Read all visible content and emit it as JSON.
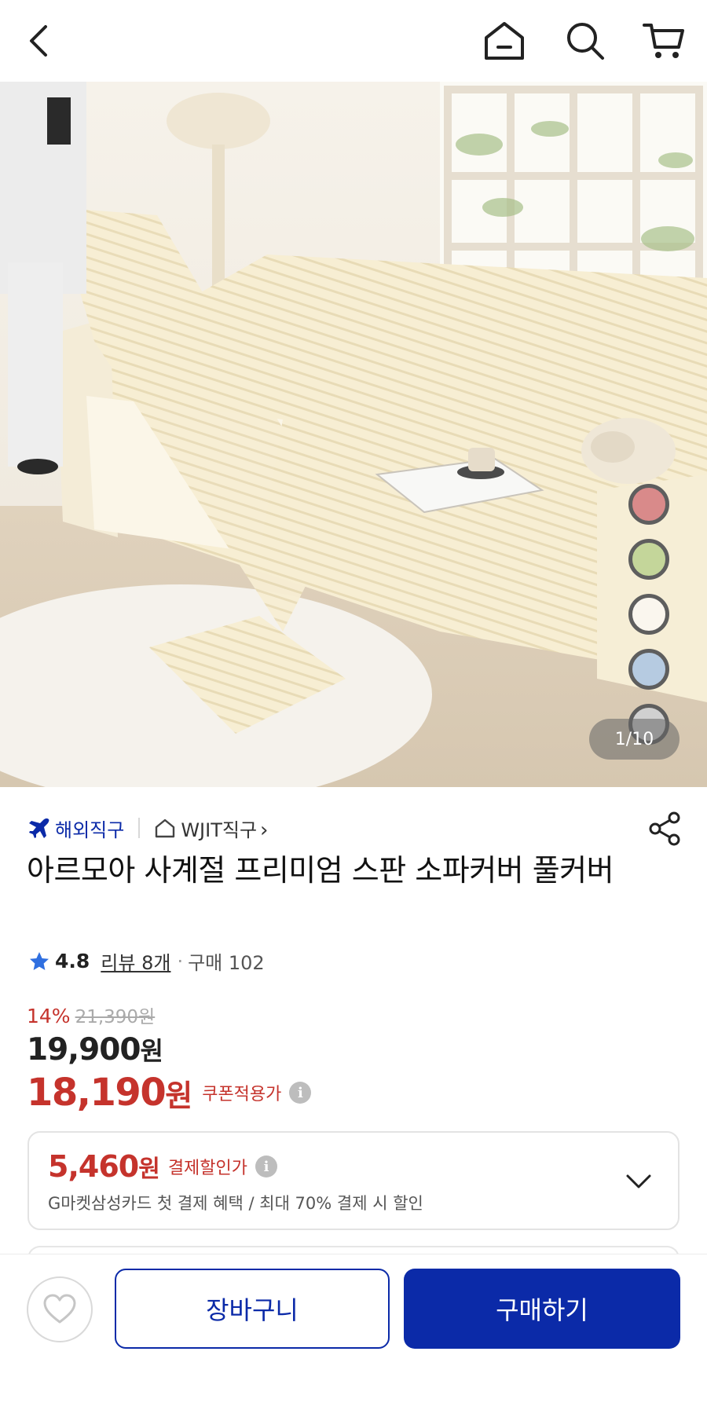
{
  "gallery": {
    "counter": "1/10",
    "swatches": [
      "#d98a8a",
      "#c4d69a",
      "#faf6ee",
      "#b6cbe1",
      "#d0d0d0"
    ]
  },
  "seller": {
    "badge": "해외직구",
    "store": "WJIT직구",
    "store_chevron": "›"
  },
  "product": {
    "title": "아르모아 사계절 프리미엄 스판 소파커버 풀커버"
  },
  "rating": {
    "score": "4.8",
    "reviews": "리뷰 8개",
    "separator": "·",
    "purchases": "구매 102"
  },
  "price": {
    "discount": "14%",
    "original": "21,390원",
    "sale_value": "19,900",
    "sale_unit": "원",
    "coupon_value": "18,190",
    "coupon_unit": "원",
    "coupon_label": "쿠폰적용가",
    "info_glyph": "i"
  },
  "payment": {
    "value": "5,460",
    "unit": "원",
    "label": "결제할인가",
    "description": "G마켓삼성카드 첫 결제 혜택 / 최대 70% 결제 시 할인"
  },
  "actions": {
    "cart": "장바구니",
    "buy": "구매하기"
  },
  "colors": {
    "brand_blue": "#0b2aa8",
    "price_red": "#c5332c",
    "star_blue": "#2f6fe0"
  }
}
